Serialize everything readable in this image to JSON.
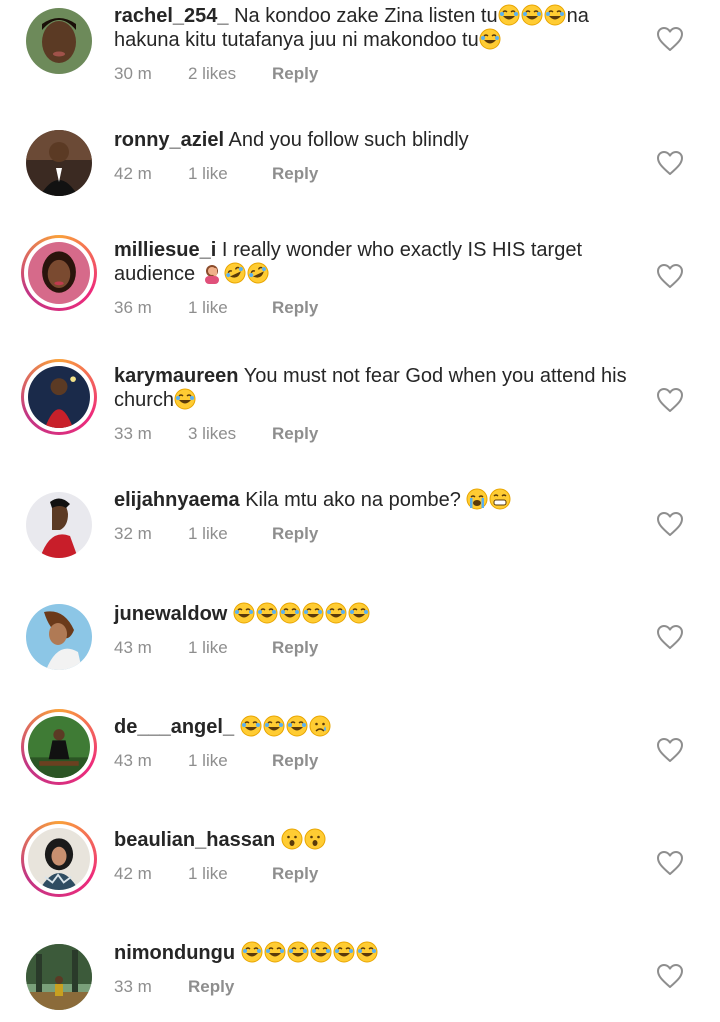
{
  "comments": [
    {
      "username": "rachel_254_",
      "text": "Na kondoo zake Zina listen tu😂😂😂na hakuna kitu tutafanya juu ni makondoo tu😂",
      "time": "30 m",
      "likes": "2 likes",
      "reply": "Reply",
      "story_ring": false,
      "avatar": "woman-portrait",
      "avatar_color": "#6d8a5a"
    },
    {
      "username": "ronny_aziel",
      "text": "And you follow such blindly",
      "time": "42 m",
      "likes": "1 like",
      "reply": "Reply",
      "story_ring": false,
      "avatar": "man-in-suit",
      "avatar_color": "#3b2a22"
    },
    {
      "username": "milliesue_i",
      "text": "I really wonder who exactly IS HIS target audience 🤦‍♀️🤣🤣",
      "time": "36 m",
      "likes": "1 like",
      "reply": "Reply",
      "story_ring": true,
      "avatar": "woman-selfie",
      "avatar_color": "#b03a4e"
    },
    {
      "username": "karymaureen",
      "text": "You must not fear God when you attend his church😂",
      "time": "33 m",
      "likes": "3 likes",
      "reply": "Reply",
      "story_ring": true,
      "avatar": "woman-red-dress",
      "avatar_color": "#c8202a"
    },
    {
      "username": "elijahnyaema",
      "text": "Kila mtu ako na pombe? 😭😁",
      "time": "32 m",
      "likes": "1 like",
      "reply": "Reply",
      "story_ring": false,
      "avatar": "man-profile",
      "avatar_color": "#e9e9ee"
    },
    {
      "username": "junewaldow",
      "text": "😂😂😂😂😂😂",
      "time": "43 m",
      "likes": "1 like",
      "reply": "Reply",
      "story_ring": false,
      "avatar": "woman-sky",
      "avatar_color": "#8cc6e6"
    },
    {
      "username": "de___angel_",
      "text": "😂😂😂😢",
      "time": "43 m",
      "likes": "1 like",
      "reply": "Reply",
      "story_ring": true,
      "avatar": "woman-garden",
      "avatar_color": "#3f7b35"
    },
    {
      "username": "beaulian_hassan",
      "text": "😮😮",
      "time": "42 m",
      "likes": "1 like",
      "reply": "Reply",
      "story_ring": true,
      "avatar": "woman-hijab",
      "avatar_color": "#2f4d62"
    },
    {
      "username": "nimondungu",
      "text": "😂😂😂😂😂😂",
      "time": "33 m",
      "likes": "",
      "reply": "Reply",
      "story_ring": false,
      "avatar": "person-forest",
      "avatar_color": "#3c5a3a"
    }
  ],
  "icons": {
    "like": "heart-outline-icon"
  },
  "colors": {
    "text": "#262626",
    "meta": "#8e8e8e",
    "ring_start": "#f9a13a",
    "ring_mid": "#ee2a7b"
  }
}
